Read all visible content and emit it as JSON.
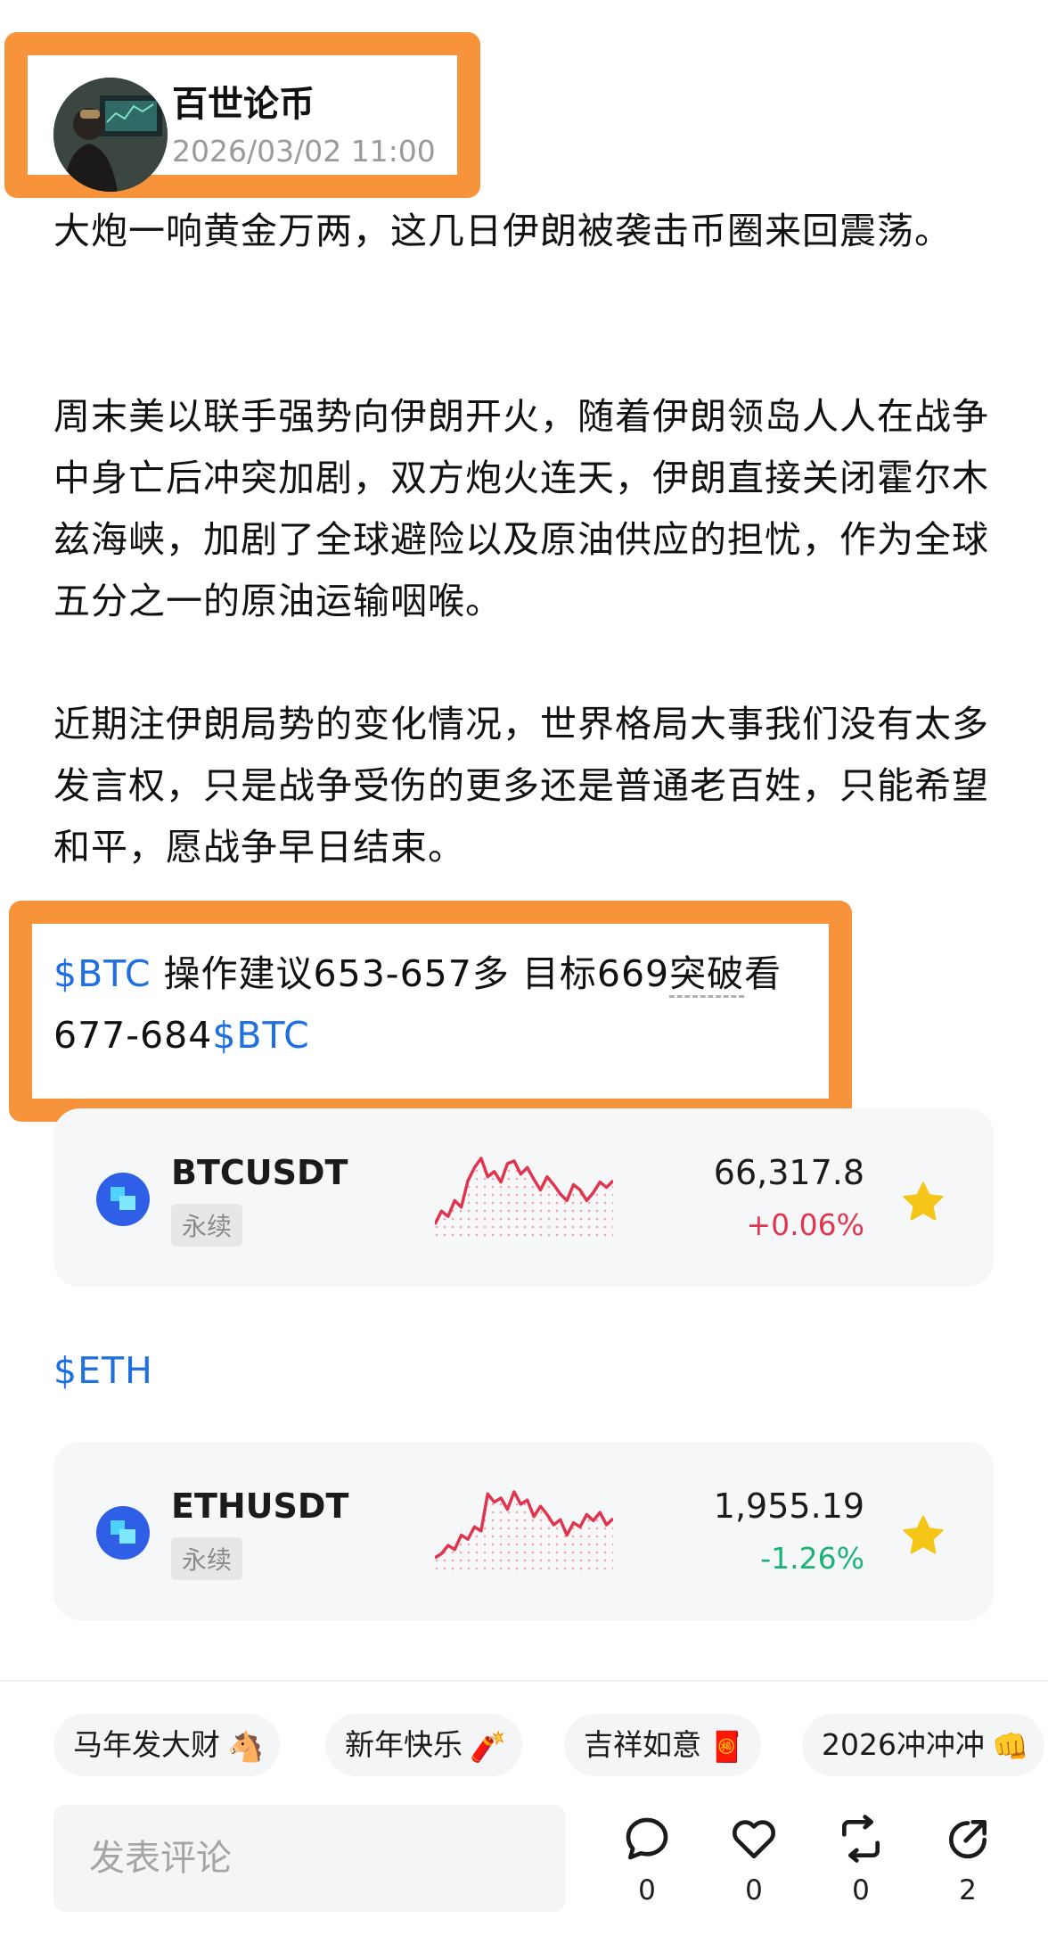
{
  "post": {
    "author": "百世论币",
    "timestamp": "2026/03/02 11:00",
    "paragraphs": [
      "大炮一响黄金万两，这几日伊朗被袭击币圈来回震荡。",
      "周末美以联手强势向伊朗开火，随着伊朗领岛人人在战争中身亡后冲突加剧，双方炮火连天，伊朗直接关闭霍尔木兹海峡，加剧了全球避险以及原油供应的担忧，作为全球五分之一的原油运输咽喉。",
      "近期注伊朗局势的变化情况，世界格局大事我们没有太多发言权，只是战争受伤的更多还是普通老百姓，只能希望和平，愿战争早日结束。"
    ],
    "trade_advice": {
      "tag_1": "$BTC",
      "text_a": " 操作建议653-657多  目标669",
      "text_b": "突破",
      "text_c": "看677-684",
      "tag_2": "$BTC"
    },
    "eth_tag": "$ETH"
  },
  "tickers": [
    {
      "symbol": "BTCUSDT",
      "badge": "永续",
      "price": "66,317.8",
      "change": "+0.06%",
      "direction": "up",
      "sparkline": [
        12,
        22,
        18,
        30,
        25,
        45,
        55,
        62,
        48,
        52,
        44,
        58,
        60,
        50,
        55,
        46,
        38,
        48,
        42,
        35,
        30,
        42,
        38,
        30,
        36,
        44,
        40,
        45
      ]
    },
    {
      "symbol": "ETHUSDT",
      "badge": "永续",
      "price": "1,955.19",
      "change": "-1.26%",
      "direction": "down",
      "sparkline": [
        8,
        12,
        20,
        16,
        30,
        26,
        38,
        34,
        70,
        62,
        66,
        55,
        72,
        60,
        64,
        48,
        58,
        50,
        40,
        45,
        30,
        42,
        38,
        50,
        44,
        52,
        40,
        46
      ]
    }
  ],
  "colors": {
    "highlight": "#f7943b",
    "cashtag": "#1e6fe0",
    "up": "#e0354f",
    "down": "#1ab276",
    "star": "#f5c518"
  },
  "reactions": [
    {
      "label": "马年发大财",
      "emoji": "🐴"
    },
    {
      "label": "新年快乐",
      "emoji": "🧨"
    },
    {
      "label": "吉祥如意",
      "emoji": "🧧"
    },
    {
      "label": "2026冲冲冲",
      "emoji": "👊"
    }
  ],
  "comment": {
    "placeholder": "发表评论"
  },
  "actions": [
    {
      "icon": "comment-icon",
      "count": "0"
    },
    {
      "icon": "heart-icon",
      "count": "0"
    },
    {
      "icon": "repost-icon",
      "count": "0"
    },
    {
      "icon": "share-icon",
      "count": "2"
    }
  ]
}
